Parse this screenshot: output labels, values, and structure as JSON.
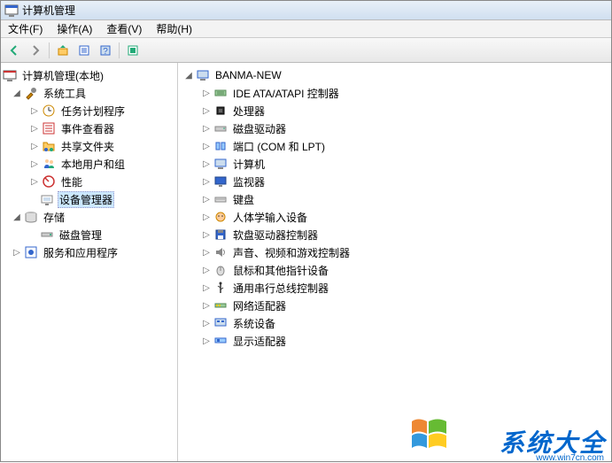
{
  "window": {
    "title": "计算机管理"
  },
  "menu": {
    "file": "文件(F)",
    "action": "操作(A)",
    "view": "查看(V)",
    "help": "帮助(H)"
  },
  "left_tree": {
    "root": "计算机管理(本地)",
    "system_tools": "系统工具",
    "task_scheduler": "任务计划程序",
    "event_viewer": "事件查看器",
    "shared_folders": "共享文件夹",
    "local_users": "本地用户和组",
    "performance": "性能",
    "device_manager": "设备管理器",
    "storage": "存储",
    "disk_mgmt": "磁盘管理",
    "services_apps": "服务和应用程序"
  },
  "right_tree": {
    "root": "BANMA-NEW",
    "ide": "IDE ATA/ATAPI 控制器",
    "cpu": "处理器",
    "disk_drives": "磁盘驱动器",
    "ports": "端口 (COM 和 LPT)",
    "computer": "计算机",
    "monitor": "监视器",
    "keyboard": "键盘",
    "hid": "人体学输入设备",
    "floppy": "软盘驱动器控制器",
    "sound": "声音、视频和游戏控制器",
    "mouse": "鼠标和其他指针设备",
    "usb": "通用串行总线控制器",
    "network": "网络适配器",
    "system_devices": "系统设备",
    "display": "显示适配器"
  },
  "watermark": {
    "text": "系统大全",
    "url": "www.win7cn.com"
  }
}
